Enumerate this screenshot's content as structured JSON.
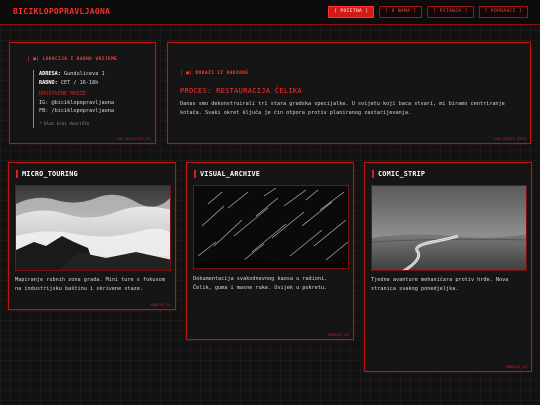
{
  "brand": "BICIKLOPOPRAVLJAONA",
  "nav": [
    {
      "label": "POČETNA",
      "active": true
    },
    {
      "label": "O NAMA",
      "active": false
    },
    {
      "label": "PITANJA",
      "active": false
    },
    {
      "label": "POPRAVCI",
      "active": false
    }
  ],
  "info": {
    "tag": "| ■| LOKACIJA I RADNO VRIJEME",
    "address_label": "ADRESA:",
    "address": "Gunduliceva 1",
    "hours_label": "RADNO:",
    "hours": "CET / 16-18h",
    "social_head": "DRUŠTVENE MREŽE",
    "ig": "IG: @biciklopopravljaona",
    "fb": "FB: /biciklopopravljaona",
    "note": "* Ulaz kroz dvorište",
    "stamp": "LOG_DATA_REF_01"
  },
  "process": {
    "tag": "| ■| DOKAZI IZ RADIONE",
    "title": "PROCES: RESTAURACIJA ČELIKA",
    "body": "Danas smo dekonstruirali tri stara gradska specijalke. U svijetu koji baca stvari, mi biramo centriranje kotača. Svaki okret ključa je čin otpora protiv planiranog zastarijevanja.",
    "stamp": "LOG_ENTRY_#255"
  },
  "cards": [
    {
      "title": "MICRO_TOURING",
      "desc": "Mapiranje rubnih zona grada. Mini ture s fokusom na industrijsku baštinu i skrivene staze.",
      "stamp": "MODULE_01",
      "photo": "fog-valley-icon"
    },
    {
      "title": "VISUAL_ARCHIVE",
      "desc": "Dokumentacija svakodnevnog kaosa u radioni. Čelik, guma i masne ruke. Uvijek u pokretu.",
      "stamp": "MODULE_02",
      "photo": "star-trails-icon"
    },
    {
      "title": "COMIC_STRIP",
      "desc": "Tjedne avanture mehaničara protiv hrđe. Nova stranica svakog ponedjeljka.",
      "stamp": "MODULE_03",
      "photo": "country-road-icon"
    }
  ],
  "colors": {
    "accent": "#e01e1e",
    "background": "#121212",
    "panel": "#151515"
  }
}
